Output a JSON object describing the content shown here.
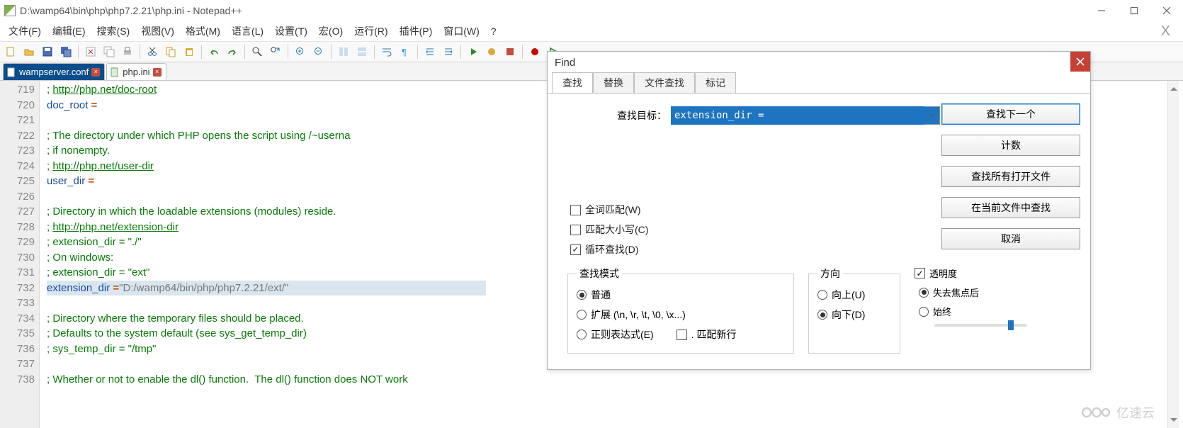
{
  "window": {
    "title": "D:\\wamp64\\bin\\php\\php7.2.21\\php.ini - Notepad++"
  },
  "menu": {
    "file": "文件(F)",
    "edit": "编辑(E)",
    "search": "搜索(S)",
    "view": "视图(V)",
    "format": "格式(M)",
    "language": "语言(L)",
    "settings": "设置(T)",
    "macro": "宏(O)",
    "run": "运行(R)",
    "plugins": "插件(P)",
    "window": "窗口(W)",
    "help": "?"
  },
  "tabs": {
    "inactive": "wampserver.conf",
    "active": "php.ini"
  },
  "gutter_start": 719,
  "code_lines": [
    {
      "t": "comment_link",
      "pre": "; ",
      "url": "http://php.net/doc-root"
    },
    {
      "t": "kv",
      "key": "doc_root",
      "val": ""
    },
    {
      "t": "blank"
    },
    {
      "t": "comment",
      "text": "; The directory under which PHP opens the script using /~userna"
    },
    {
      "t": "comment",
      "text": "; if nonempty."
    },
    {
      "t": "comment_link",
      "pre": "; ",
      "url": "http://php.net/user-dir"
    },
    {
      "t": "kv",
      "key": "user_dir",
      "val": ""
    },
    {
      "t": "blank"
    },
    {
      "t": "comment",
      "text": "; Directory in which the loadable extensions (modules) reside."
    },
    {
      "t": "comment_link",
      "pre": "; ",
      "url": "http://php.net/extension-dir"
    },
    {
      "t": "comment",
      "text": "; extension_dir = \"./\""
    },
    {
      "t": "comment",
      "text": "; On windows:"
    },
    {
      "t": "comment",
      "text": "; extension_dir = \"ext\""
    },
    {
      "t": "kv_hl",
      "key": "extension_dir",
      "val": "\"D:/wamp64/bin/php/php7.2.21/ext/\""
    },
    {
      "t": "blank"
    },
    {
      "t": "comment",
      "text": "; Directory where the temporary files should be placed."
    },
    {
      "t": "comment",
      "text": "; Defaults to the system default (see sys_get_temp_dir)"
    },
    {
      "t": "comment",
      "text": "; sys_temp_dir = \"/tmp\""
    },
    {
      "t": "blank"
    },
    {
      "t": "comment",
      "text": "; Whether or not to enable the dl() function.  The dl() function does NOT work"
    }
  ],
  "find": {
    "title": "Find",
    "tabs": {
      "find": "查找",
      "replace": "替换",
      "findfiles": "文件查找",
      "mark": "标记"
    },
    "label_target": "查找目标：",
    "value": "extension_dir =",
    "btn_next": "查找下一个",
    "btn_count": "计数",
    "btn_all_open": "查找所有打开文件",
    "btn_current": "在当前文件中查找",
    "btn_cancel": "取消",
    "chk_whole": "全词匹配(W)",
    "chk_case": "匹配大小写(C)",
    "chk_wrap": "循环查找(D)",
    "grp_mode": "查找模式",
    "mode_normal": "普通",
    "mode_ext": "扩展 (\\n, \\r, \\t, \\0, \\x...)",
    "mode_regex": "正则表达式(E)",
    "mode_newline": ". 匹配新行",
    "grp_dir": "方向",
    "dir_up": "向上(U)",
    "dir_down": "向下(D)",
    "grp_trans": "透明度",
    "trans_focus": "失去焦点后",
    "trans_always": "始终"
  },
  "watermark": "亿速云"
}
